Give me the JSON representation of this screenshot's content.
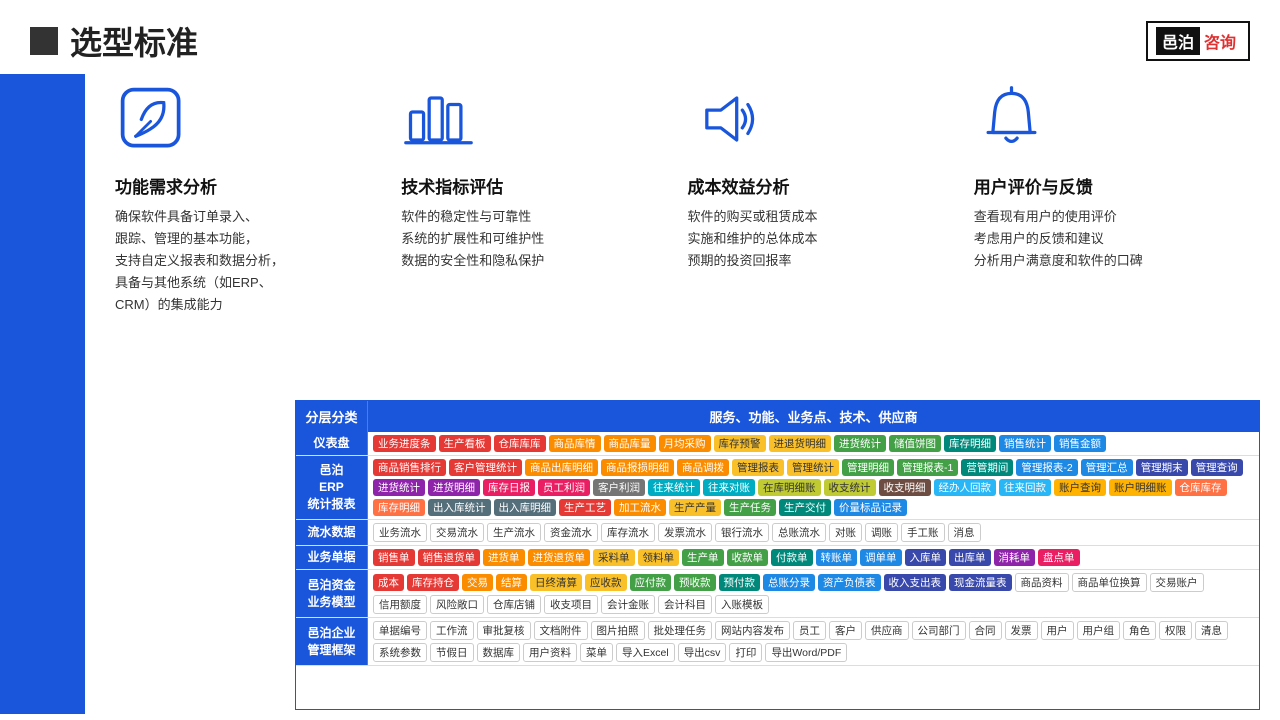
{
  "header": {
    "title": "选型标准",
    "logo_black": "邑泊",
    "logo_red": "咨询"
  },
  "sections": [
    {
      "id": "section1",
      "title": "功能需求分析",
      "desc": "确保软件具备订单录入、\n跟踪、管理的基本功能，\n支持自定义报表和数据分析，\n具备与其他系统（如ERP、\nCRM）的集成能力",
      "icon": "leaf"
    },
    {
      "id": "section2",
      "title": "技术指标评估",
      "desc": "软件的稳定性与可靠性\n系统的扩展性和可维护性\n数据的安全性和隐私保护",
      "icon": "bar-chart"
    },
    {
      "id": "section3",
      "title": "成本效益分析",
      "desc": "软件的购买或租赁成本\n实施和维护的总体成本\n预期的投资回报率",
      "icon": "speaker"
    },
    {
      "id": "section4",
      "title": "用户评价与反馈",
      "desc": "查看现有用户的使用评价\n考虑用户的反馈和建议\n分析用户满意度和软件的口碑",
      "icon": "bell"
    }
  ],
  "table": {
    "header_label": "分层分类",
    "header_content": "服务、功能、业务点、技术、供应商",
    "rows": [
      {
        "label": "仪表盘",
        "tags": [
          {
            "text": "业务进度条",
            "color": "red"
          },
          {
            "text": "生产看板",
            "color": "red"
          },
          {
            "text": "仓库库库",
            "color": "red"
          },
          {
            "text": "商品库情",
            "color": "orange"
          },
          {
            "text": "商品库量",
            "color": "orange"
          },
          {
            "text": "月均采购",
            "color": "orange"
          },
          {
            "text": "库存预警",
            "color": "yellow"
          },
          {
            "text": "进退货明细",
            "color": "yellow"
          },
          {
            "text": "进货统计",
            "color": "green"
          },
          {
            "text": "储值饼图",
            "color": "green"
          },
          {
            "text": "库存明细",
            "color": "teal"
          },
          {
            "text": "销售统计",
            "color": "blue"
          },
          {
            "text": "销售金额",
            "color": "blue"
          }
        ]
      },
      {
        "label": "邑泊\nERP\n统计报表",
        "tags": [
          {
            "text": "商品销售排行",
            "color": "red"
          },
          {
            "text": "客户管理统计",
            "color": "red"
          },
          {
            "text": "商品出库明细",
            "color": "orange"
          },
          {
            "text": "商品报损明细",
            "color": "orange"
          },
          {
            "text": "商品调拨",
            "color": "orange"
          },
          {
            "text": "管理报表",
            "color": "yellow"
          },
          {
            "text": "管理统计",
            "color": "yellow"
          },
          {
            "text": "管理明细",
            "color": "green"
          },
          {
            "text": "管理报表-1",
            "color": "green"
          },
          {
            "text": "营管期间",
            "color": "teal"
          },
          {
            "text": "管理报表-2",
            "color": "blue"
          },
          {
            "text": "管理汇总",
            "color": "blue"
          },
          {
            "text": "管理期末",
            "color": "indigo"
          },
          {
            "text": "管理查询",
            "color": "indigo"
          },
          {
            "text": "进货统计",
            "color": "purple"
          },
          {
            "text": "进货明细",
            "color": "purple"
          },
          {
            "text": "库存日报",
            "color": "pink"
          },
          {
            "text": "员工利润",
            "color": "pink"
          },
          {
            "text": "客户利润",
            "color": "gray"
          },
          {
            "text": "往来统计",
            "color": "cyan"
          },
          {
            "text": "往来对账",
            "color": "cyan"
          },
          {
            "text": "在库明细账",
            "color": "lime"
          },
          {
            "text": "收支统计",
            "color": "lime"
          },
          {
            "text": "收支明细",
            "color": "brown"
          },
          {
            "text": "经办人回款",
            "color": "light-blue"
          },
          {
            "text": "往来回款",
            "color": "light-blue"
          },
          {
            "text": "账户查询",
            "color": "amber"
          },
          {
            "text": "账户明细账",
            "color": "amber"
          },
          {
            "text": "仓库库存",
            "color": "deep-orange"
          },
          {
            "text": "库存明细",
            "color": "deep-orange"
          },
          {
            "text": "出入库统计",
            "color": "blue-grey"
          },
          {
            "text": "出入库明细",
            "color": "blue-grey"
          },
          {
            "text": "生产工艺",
            "color": "red"
          },
          {
            "text": "加工流水",
            "color": "orange"
          },
          {
            "text": "生产产量",
            "color": "yellow"
          },
          {
            "text": "生产任务",
            "color": "green"
          },
          {
            "text": "生产交付",
            "color": "teal"
          },
          {
            "text": "价量标品记录",
            "color": "blue"
          }
        ]
      },
      {
        "label": "流水数据",
        "tags": [
          {
            "text": "业务流水",
            "color": "outline"
          },
          {
            "text": "交易流水",
            "color": "outline"
          },
          {
            "text": "生产流水",
            "color": "outline"
          },
          {
            "text": "资金流水",
            "color": "outline"
          },
          {
            "text": "库存流水",
            "color": "outline"
          },
          {
            "text": "发票流水",
            "color": "outline"
          },
          {
            "text": "银行流水",
            "color": "outline"
          },
          {
            "text": "总账流水",
            "color": "outline"
          },
          {
            "text": "对账",
            "color": "outline"
          },
          {
            "text": "调账",
            "color": "outline"
          },
          {
            "text": "手工账",
            "color": "outline"
          },
          {
            "text": "消息",
            "color": "outline"
          }
        ]
      },
      {
        "label": "业务单据",
        "tags": [
          {
            "text": "销售单",
            "color": "red"
          },
          {
            "text": "销售退货单",
            "color": "red"
          },
          {
            "text": "进货单",
            "color": "orange"
          },
          {
            "text": "进货退货单",
            "color": "orange"
          },
          {
            "text": "采料单",
            "color": "yellow"
          },
          {
            "text": "领料单",
            "color": "yellow"
          },
          {
            "text": "生产单",
            "color": "green"
          },
          {
            "text": "收款单",
            "color": "green"
          },
          {
            "text": "付款单",
            "color": "teal"
          },
          {
            "text": "转账单",
            "color": "blue"
          },
          {
            "text": "调单单",
            "color": "blue"
          },
          {
            "text": "入库单",
            "color": "indigo"
          },
          {
            "text": "出库单",
            "color": "indigo"
          },
          {
            "text": "消耗单",
            "color": "purple"
          },
          {
            "text": "盘点单",
            "color": "pink"
          }
        ]
      },
      {
        "label": "邑泊资金\n业务模型",
        "tags": [
          {
            "text": "成本",
            "color": "red"
          },
          {
            "text": "库存持仓",
            "color": "red"
          },
          {
            "text": "交易",
            "color": "orange"
          },
          {
            "text": "结算",
            "color": "orange"
          },
          {
            "text": "日终清算",
            "color": "yellow"
          },
          {
            "text": "应收款",
            "color": "yellow"
          },
          {
            "text": "应付款",
            "color": "green"
          },
          {
            "text": "预收款",
            "color": "green"
          },
          {
            "text": "预付款",
            "color": "teal"
          },
          {
            "text": "总账分录",
            "color": "blue"
          },
          {
            "text": "资产负债表",
            "color": "blue"
          },
          {
            "text": "收入支出表",
            "color": "indigo"
          },
          {
            "text": "现金流量表",
            "color": "indigo"
          },
          {
            "text": "商品资料",
            "color": "outline"
          },
          {
            "text": "商品单位换算",
            "color": "outline"
          },
          {
            "text": "交易账户",
            "color": "outline"
          },
          {
            "text": "信用额度",
            "color": "outline"
          },
          {
            "text": "风险敞口",
            "color": "outline"
          },
          {
            "text": "仓库店铺",
            "color": "outline"
          },
          {
            "text": "收支项目",
            "color": "outline"
          },
          {
            "text": "会计金账",
            "color": "outline"
          },
          {
            "text": "会计科目",
            "color": "outline"
          },
          {
            "text": "入账模板",
            "color": "outline"
          }
        ]
      },
      {
        "label": "邑泊企业\n管理框架",
        "tags": [
          {
            "text": "单据编号",
            "color": "outline"
          },
          {
            "text": "工作流",
            "color": "outline"
          },
          {
            "text": "审批复核",
            "color": "outline"
          },
          {
            "text": "文档附件",
            "color": "outline"
          },
          {
            "text": "图片拍照",
            "color": "outline"
          },
          {
            "text": "批处理任务",
            "color": "outline"
          },
          {
            "text": "网站内容发布",
            "color": "outline"
          },
          {
            "text": "员工",
            "color": "outline"
          },
          {
            "text": "客户",
            "color": "outline"
          },
          {
            "text": "供应商",
            "color": "outline"
          },
          {
            "text": "公司部门",
            "color": "outline"
          },
          {
            "text": "合同",
            "color": "outline"
          },
          {
            "text": "发票",
            "color": "outline"
          },
          {
            "text": "用户",
            "color": "outline"
          },
          {
            "text": "用户组",
            "color": "outline"
          },
          {
            "text": "角色",
            "color": "outline"
          },
          {
            "text": "权限",
            "color": "outline"
          },
          {
            "text": "清息",
            "color": "outline"
          },
          {
            "text": "系统参数",
            "color": "outline"
          },
          {
            "text": "节假日",
            "color": "outline"
          },
          {
            "text": "数据库",
            "color": "outline"
          },
          {
            "text": "用户资料",
            "color": "outline"
          },
          {
            "text": "菜单",
            "color": "outline"
          },
          {
            "text": "导入Excel",
            "color": "outline"
          },
          {
            "text": "导出csv",
            "color": "outline"
          },
          {
            "text": "打印",
            "color": "outline"
          },
          {
            "text": "导出Word/PDF",
            "color": "outline"
          }
        ]
      }
    ]
  }
}
